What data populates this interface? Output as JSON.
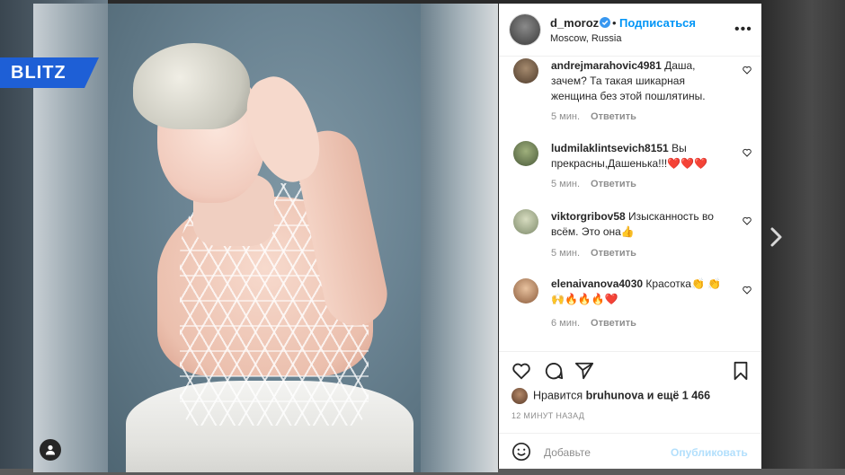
{
  "brand": {
    "logo_text": "BLITZ",
    "logo_color": "#1e5fd6"
  },
  "post": {
    "username": "d_moroz",
    "follow_label": "Подписаться",
    "dot": "•",
    "location": "Moscow, Russia",
    "more_icon": "more-options-icon",
    "more_label": "•••"
  },
  "comments": [
    {
      "username": "andrejmarahovic4981",
      "text": " Даша, зачем? Та такая шикарная женщина без этой пошлятины.",
      "time": "5 мин.",
      "reply": "Ответить"
    },
    {
      "username": "ludmilaklintsevich8151",
      "text": " Вы прекрасны,Дашенька!!!❤️❤️❤️",
      "time": "5 мин.",
      "reply": "Ответить"
    },
    {
      "username": "viktorgribov58",
      "text": " Изысканность во всём. Это она👍",
      "time": "5 мин.",
      "reply": "Ответить"
    },
    {
      "username": "elenaivanova4030",
      "text": " Красотка👏 👏🙌🔥🔥🔥❤️",
      "time": "6 мин.",
      "reply": "Ответить"
    }
  ],
  "likes": {
    "prefix": "Нравится ",
    "user": "bruhunova",
    "suffix": " и ещё 1 466"
  },
  "timestamp": "12 МИНУТ НАЗАД",
  "comment_box": {
    "placeholder": "Добавьте",
    "publish_label": "Опубликовать"
  },
  "colors": {
    "link": "#0095f6",
    "publish_disabled": "#b2dffc",
    "verified": "#3897f0"
  }
}
